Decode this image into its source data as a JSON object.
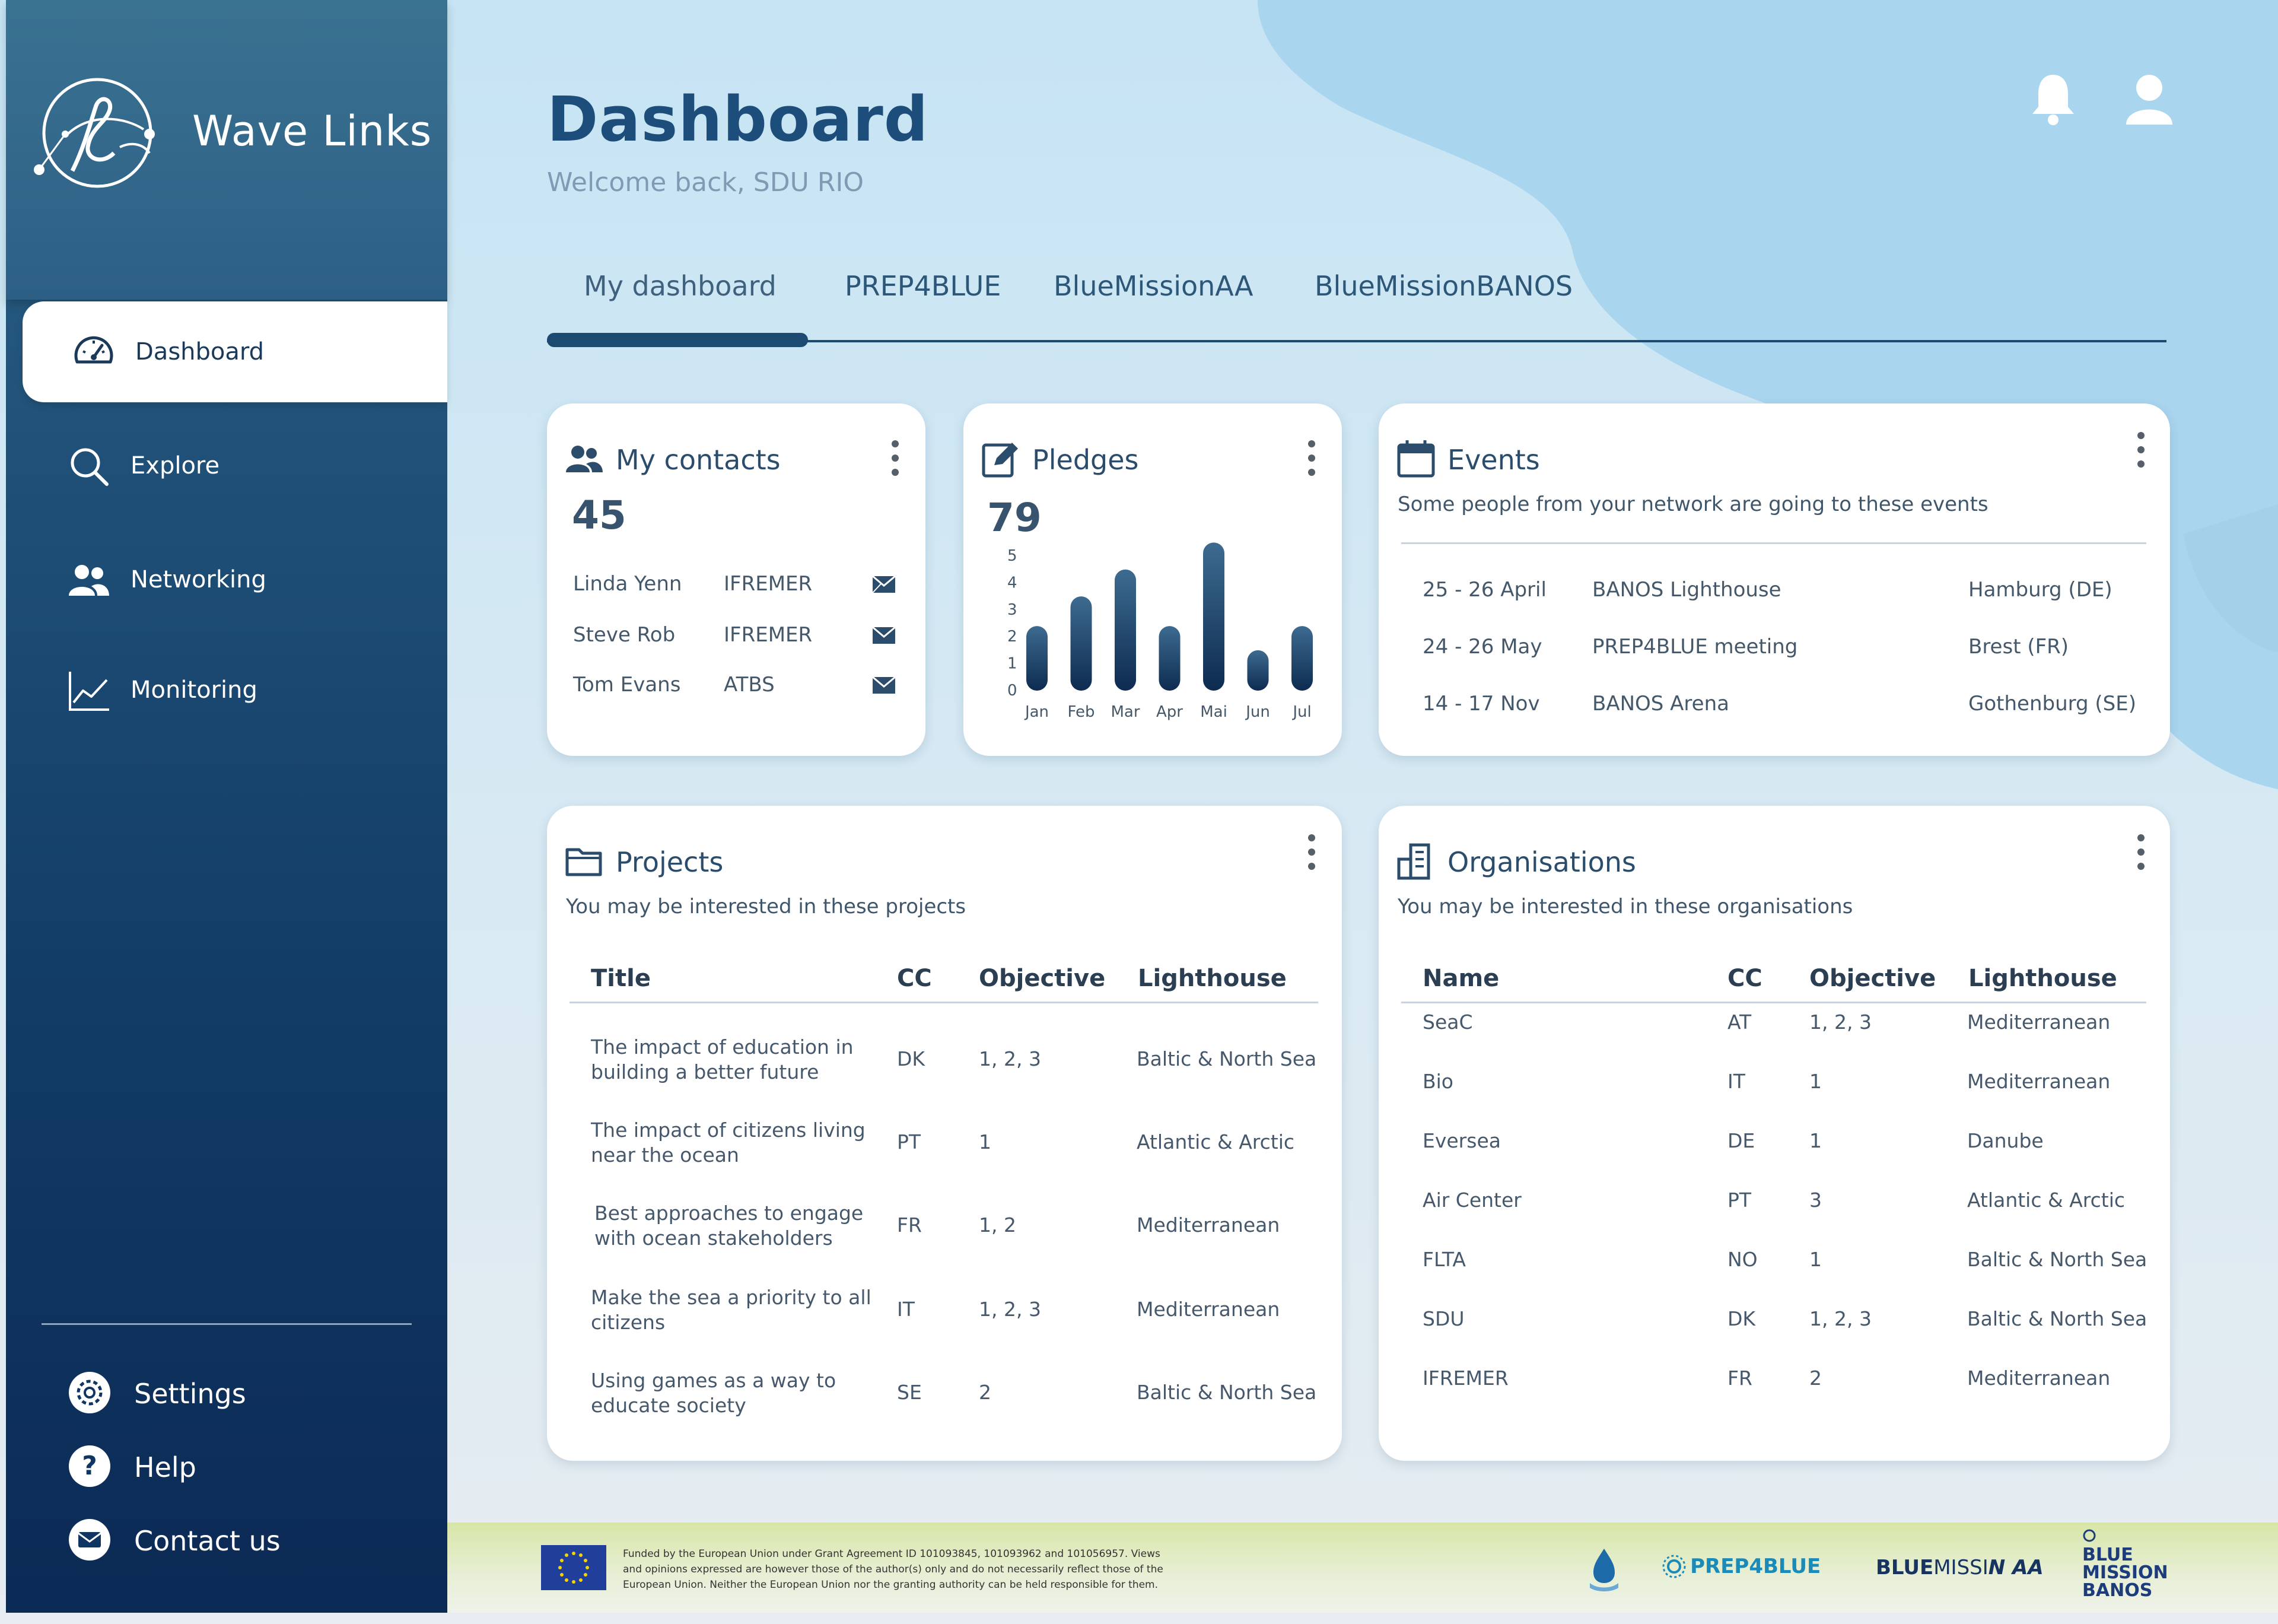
{
  "app": {
    "name": "Wave Links"
  },
  "sidebar": {
    "items": [
      {
        "label": "Dashboard",
        "icon": "speedometer-icon",
        "active": true
      },
      {
        "label": "Explore",
        "icon": "search-icon"
      },
      {
        "label": "Networking",
        "icon": "users-icon"
      },
      {
        "label": "Monitoring",
        "icon": "line-chart-icon"
      }
    ],
    "bottom": [
      {
        "label": "Settings",
        "icon": "gear-icon"
      },
      {
        "label": "Help",
        "icon": "help-icon"
      },
      {
        "label": "Contact us",
        "icon": "mail-icon"
      }
    ]
  },
  "header": {
    "title": "Dashboard",
    "welcome": "Welcome back,  SDU RIO"
  },
  "tabs": [
    {
      "label": "My dashboard",
      "active": true
    },
    {
      "label": "PREP4BLUE"
    },
    {
      "label": "BlueMissionAA"
    },
    {
      "label": "BlueMissionBANOS"
    }
  ],
  "contacts": {
    "title": "My contacts",
    "count": "45",
    "rows": [
      {
        "name": "Linda Yenn",
        "org": "IFREMER"
      },
      {
        "name": "Steve Rob",
        "org": "IFREMER"
      },
      {
        "name": "Tom Evans",
        "org": "ATBS"
      }
    ]
  },
  "pledges": {
    "title": "Pledges",
    "count": "79"
  },
  "chart_data": {
    "type": "bar",
    "categories": [
      "Jan",
      "Feb",
      "Mar",
      "Apr",
      "Mai",
      "Jun",
      "Jul"
    ],
    "values": [
      2.4,
      3.5,
      4.5,
      2.4,
      5.5,
      1.5,
      2.4
    ],
    "ylim": [
      0,
      5
    ],
    "yticks": [
      "0",
      "1",
      "2",
      "3",
      "4",
      "5"
    ],
    "colors": {
      "top": "#3d6b90",
      "bottom": "#0e2b50"
    }
  },
  "events": {
    "title": "Events",
    "subtitle": "Some people from your network are going to these events",
    "rows": [
      {
        "date": "25 - 26 April",
        "name": "BANOS Lighthouse",
        "place": "Hamburg (DE)"
      },
      {
        "date": "24 - 26 May",
        "name": "PREP4BLUE meeting",
        "place": "Brest (FR)"
      },
      {
        "date": "14 - 17 Nov",
        "name": "BANOS Arena",
        "place": "Gothenburg (SE)"
      }
    ]
  },
  "projects": {
    "title": "Projects",
    "subtitle": "You may be interested in these projects",
    "headers": [
      "Title",
      "CC",
      "Objective",
      "Lighthouse"
    ],
    "rows": [
      {
        "title1": "The impact of education in",
        "title2": "building a better future",
        "cc": "DK",
        "obj": "1, 2, 3",
        "lh": "Baltic & North Sea"
      },
      {
        "title1": "The impact of citizens living",
        "title2": "near the ocean",
        "cc": "PT",
        "obj": "1",
        "lh": "Atlantic & Arctic"
      },
      {
        "title1": "Best approaches to engage",
        "title2": "with ocean stakeholders",
        "cc": "FR",
        "obj": "1, 2",
        "lh": "Mediterranean"
      },
      {
        "title1": "Make the sea a priority to all",
        "title2": "citizens",
        "cc": "IT",
        "obj": "1, 2, 3",
        "lh": "Mediterranean"
      },
      {
        "title1": "Using games as a way to",
        "title2": "educate society",
        "cc": "SE",
        "obj": "2",
        "lh": "Baltic & North Sea"
      }
    ]
  },
  "organisations": {
    "title": "Organisations",
    "subtitle": "You may be interested in these organisations",
    "headers": [
      "Name",
      "CC",
      "Objective",
      "Lighthouse"
    ],
    "rows": [
      {
        "name": "SeaC",
        "cc": "AT",
        "obj": "1, 2, 3",
        "lh": "Mediterranean"
      },
      {
        "name": "Bio",
        "cc": "IT",
        "obj": "1",
        "lh": "Mediterranean"
      },
      {
        "name": "Eversea",
        "cc": "DE",
        "obj": "1",
        "lh": "Danube"
      },
      {
        "name": "Air Center",
        "cc": "PT",
        "obj": "3",
        "lh": "Atlantic & Arctic"
      },
      {
        "name": "FLTA",
        "cc": "NO",
        "obj": "1",
        "lh": "Baltic & North Sea"
      },
      {
        "name": "SDU",
        "cc": "DK",
        "obj": "1, 2, 3",
        "lh": "Baltic & North Sea"
      },
      {
        "name": "IFREMER",
        "cc": "FR",
        "obj": "2",
        "lh": "Mediterranean"
      }
    ]
  },
  "footer": {
    "disclaimer1": "Funded by the European Union under Grant Agreement ID 101093845, 101093962 and 101056957. Views",
    "disclaimer2": "and opinions expressed are however those of the author(s) only and do not necessarily reflect those of the",
    "disclaimer3": "European Union. Neither the European Union nor the granting authority can be held responsible for them.",
    "logo_prep": "PREP4BLUE",
    "logo_bma_1": "BLUE",
    "logo_bma_2": "MISSI",
    "logo_bma_3": "N AA",
    "logo_banos_1": "BLUE",
    "logo_banos_2": "MISSION",
    "logo_banos_3": "BANOS"
  }
}
